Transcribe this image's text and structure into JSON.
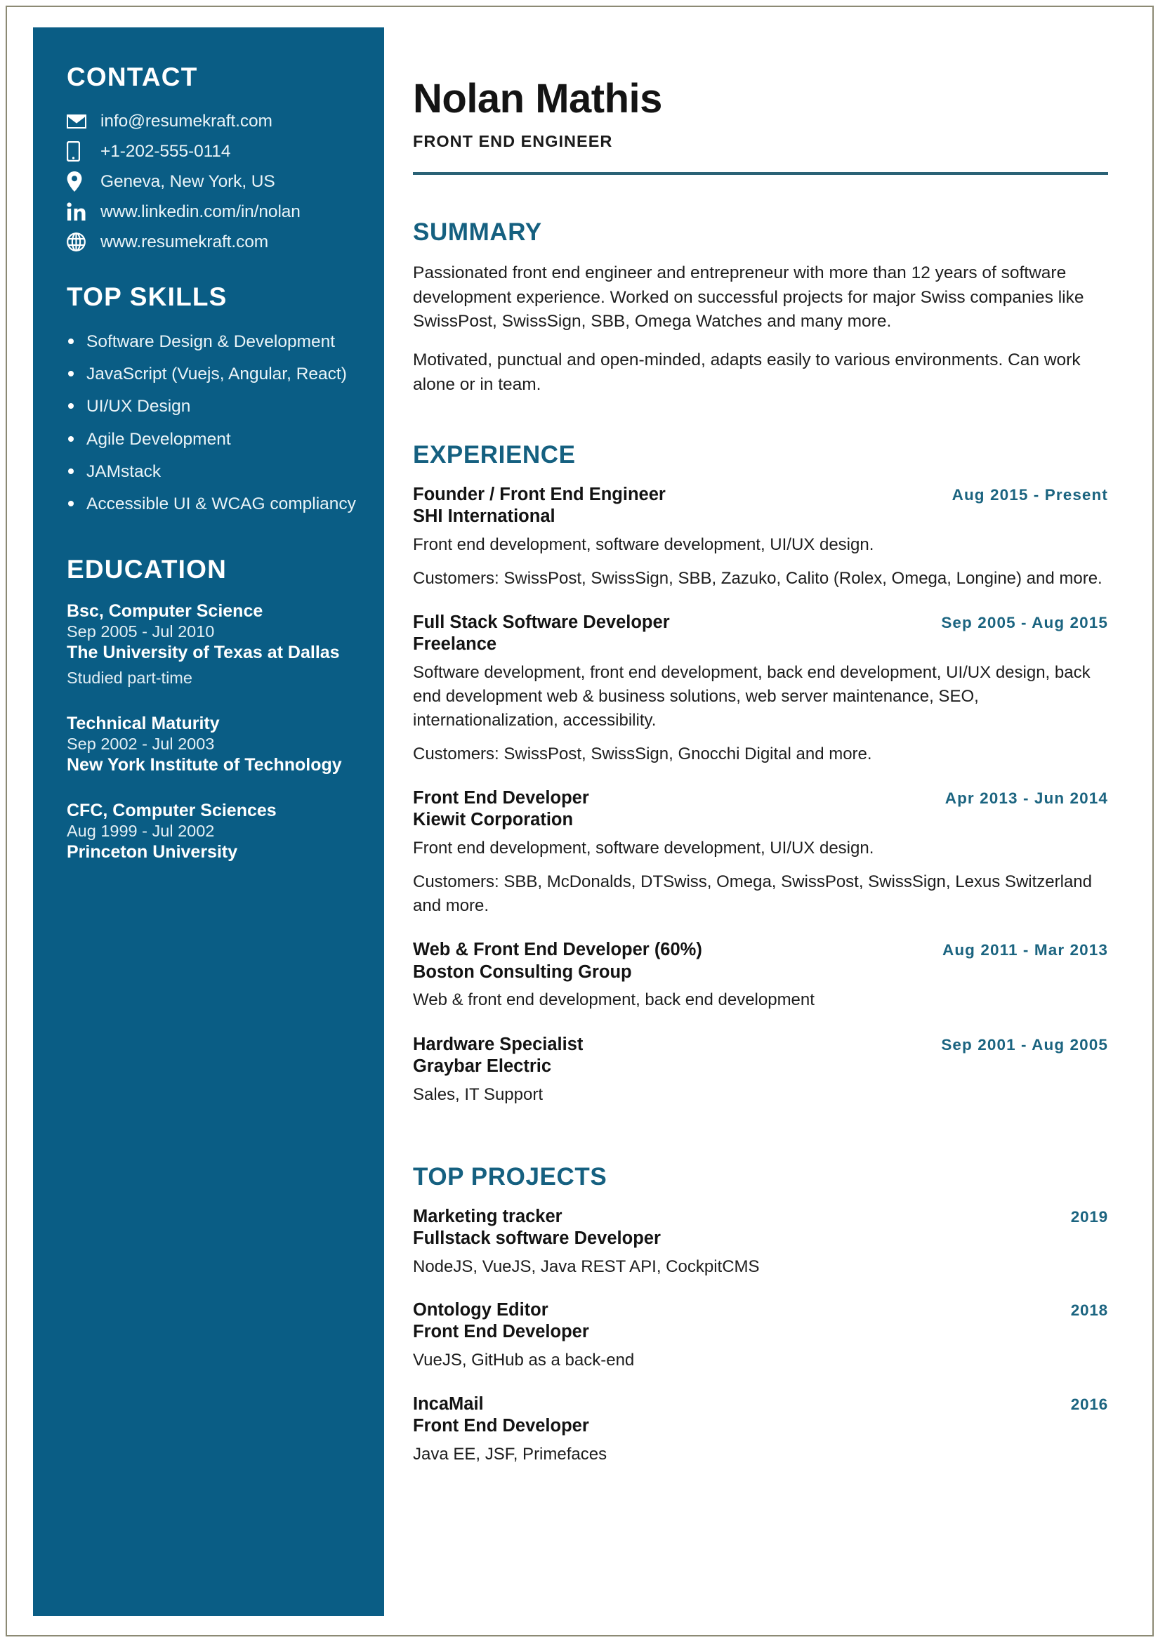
{
  "document": {
    "type": "resume",
    "accent_color": "#156080",
    "sidebar_color": "#0a5d85",
    "date_color": "#1b6480"
  },
  "header": {
    "name": "Nolan Mathis",
    "job_title": "FRONT END ENGINEER"
  },
  "sidebar": {
    "contact": {
      "heading": "CONTACT",
      "items": [
        {
          "icon": "envelope-icon",
          "value": "info@resumekraft.com"
        },
        {
          "icon": "phone-icon",
          "value": "+1-202-555-0114"
        },
        {
          "icon": "location-pin-icon",
          "value": "Geneva, New York, US"
        },
        {
          "icon": "linkedin-icon",
          "value": "www.linkedin.com/in/nolan"
        },
        {
          "icon": "globe-icon",
          "value": "www.resumekraft.com"
        }
      ]
    },
    "skills": {
      "heading": "TOP SKILLS",
      "items": [
        "Software Design & Development",
        "JavaScript (Vuejs, Angular, React)",
        "UI/UX Design",
        "Agile Development",
        "JAMstack",
        "Accessible UI & WCAG compliancy"
      ]
    },
    "education": {
      "heading": "EDUCATION",
      "items": [
        {
          "degree": "Bsc, Computer Science",
          "dates": "Sep 2005 - Jul 2010",
          "school": "The University of Texas at Dallas",
          "note": "Studied part-time"
        },
        {
          "degree": "Technical Maturity",
          "dates": "Sep 2002 - Jul 2003",
          "school": "New York Institute of Technology",
          "note": ""
        },
        {
          "degree": "CFC, Computer Sciences",
          "dates": "Aug 1999 - Jul 2002",
          "school": "Princeton University",
          "note": ""
        }
      ]
    }
  },
  "main": {
    "summary": {
      "heading": "SUMMARY",
      "paragraphs": [
        "Passionated front end engineer and entrepreneur with more than 12 years of software development experience. Worked on successful projects for major Swiss companies like SwissPost, SwissSign, SBB, Omega Watches and many more.",
        "Motivated, punctual and open-minded, adapts easily to various environments. Can work alone or in team."
      ]
    },
    "experience": {
      "heading": "EXPERIENCE",
      "items": [
        {
          "role": "Founder / Front End Engineer",
          "dates": "Aug 2015 - Present",
          "organization": "SHI International",
          "descriptions": [
            "Front end development, software development, UI/UX design.",
            "Customers: SwissPost, SwissSign, SBB, Zazuko, Calito (Rolex, Omega, Longine) and more."
          ]
        },
        {
          "role": "Full Stack Software Developer",
          "dates": "Sep 2005 - Aug 2015",
          "organization": "Freelance",
          "descriptions": [
            "Software development, front end development, back end development, UI/UX design, back end development web & business solutions, web server maintenance, SEO, internationalization, accessibility.",
            "Customers: SwissPost, SwissSign, Gnocchi Digital and more."
          ]
        },
        {
          "role": "Front End Developer",
          "dates": "Apr 2013 - Jun 2014",
          "organization": "Kiewit Corporation",
          "descriptions": [
            "Front end development, software development, UI/UX design.",
            "Customers: SBB, McDonalds, DTSwiss, Omega, SwissPost, SwissSign, Lexus Switzerland and more."
          ]
        },
        {
          "role": "Web & Front End Developer (60%)",
          "dates": "Aug 2011 - Mar 2013",
          "organization": "Boston Consulting Group",
          "descriptions": [
            "Web & front end development, back end development"
          ]
        },
        {
          "role": "Hardware Specialist",
          "dates": "Sep 2001 - Aug 2005",
          "organization": "Graybar Electric",
          "descriptions": [
            "Sales, IT Support"
          ]
        }
      ]
    },
    "projects": {
      "heading": "TOP PROJECTS",
      "items": [
        {
          "name": "Marketing tracker",
          "year": "2019",
          "role": "Fullstack software Developer",
          "tech": "NodeJS, VueJS, Java REST API, CockpitCMS"
        },
        {
          "name": "Ontology Editor",
          "year": "2018",
          "role": "Front End Developer",
          "tech": "VueJS, GitHub as a back-end"
        },
        {
          "name": "IncaMail",
          "year": "2016",
          "role": "Front End Developer",
          "tech": "Java EE, JSF, Primefaces"
        }
      ]
    }
  }
}
